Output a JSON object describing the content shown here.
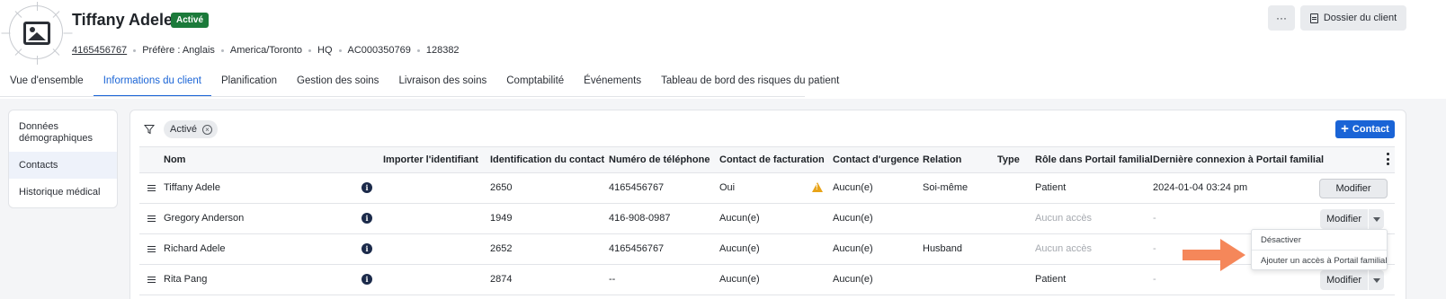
{
  "client": {
    "name": "Tiffany Adele",
    "status": "Activé",
    "phone": "4165456767",
    "language": "Préfère : Anglais",
    "timezone": "America/Toronto",
    "location": "HQ",
    "account": "AC000350769",
    "id": "128382"
  },
  "header_actions": {
    "more_label": "···",
    "dossier_label": "Dossier du client"
  },
  "tabs": [
    {
      "label": "Vue d'ensemble"
    },
    {
      "label": "Informations du client",
      "active": true
    },
    {
      "label": "Planification"
    },
    {
      "label": "Gestion des soins"
    },
    {
      "label": "Livraison des soins"
    },
    {
      "label": "Comptabilité"
    },
    {
      "label": "Événements"
    },
    {
      "label": "Tableau de bord des risques du patient"
    }
  ],
  "sidebar": {
    "items": [
      {
        "label": "Données démographiques"
      },
      {
        "label": "Contacts",
        "active": true
      },
      {
        "label": "Historique médical"
      }
    ]
  },
  "filter": {
    "chip_label": "Activé"
  },
  "add_contact_label": "Contact",
  "table": {
    "columns": [
      "Nom",
      "Importer l'identifiant",
      "Identification du contact",
      "Numéro de téléphone",
      "Contact de facturation",
      "Contact d'urgence",
      "Relation",
      "Type",
      "Rôle dans Portail familial",
      "Dernière connexion à Portail familial"
    ],
    "rows": [
      {
        "name": "Tiffany Adele",
        "contact_id": "2650",
        "phone": "4165456767",
        "billing": "Oui",
        "emergency": "Aucun(e)",
        "relation": "Soi-même",
        "type": "",
        "portal_role": "Patient",
        "last_login": "2024-01-04 03:24 pm",
        "action": "Modifier"
      },
      {
        "name": "Gregory Anderson",
        "contact_id": "1949",
        "phone": "416-908-0987",
        "billing": "Aucun(e)",
        "emergency": "Aucun(e)",
        "relation": "",
        "type": "",
        "portal_role": "Aucun accès",
        "last_login": "-",
        "action": "Modifier"
      },
      {
        "name": "Richard Adele",
        "contact_id": "2652",
        "phone": "4165456767",
        "billing": "Aucun(e)",
        "emergency": "Aucun(e)",
        "relation": "Husband",
        "type": "",
        "portal_role": "Aucun accès",
        "last_login": "-",
        "action": "Modifier"
      },
      {
        "name": "Rita Pang",
        "contact_id": "2874",
        "phone": "--",
        "billing": "Aucun(e)",
        "emergency": "Aucun(e)",
        "relation": "",
        "type": "",
        "portal_role": "Patient",
        "last_login": "-",
        "action": "Modifier"
      }
    ]
  },
  "dropdown": {
    "items": [
      "Désactiver",
      "Ajouter un accès à Portail familial"
    ]
  },
  "colors": {
    "accent": "#1a64d6",
    "status_active": "#1b7a3a",
    "annotation_arrow": "#f5875a",
    "warning": "#e8a318"
  },
  "icons": [
    "image-placeholder-icon",
    "document-icon",
    "filter-icon",
    "close-circle-icon",
    "plus-icon",
    "kebab-icon",
    "drag-handle-icon",
    "info-icon",
    "warning-icon",
    "chevron-down-icon",
    "arrow-right-icon"
  ]
}
